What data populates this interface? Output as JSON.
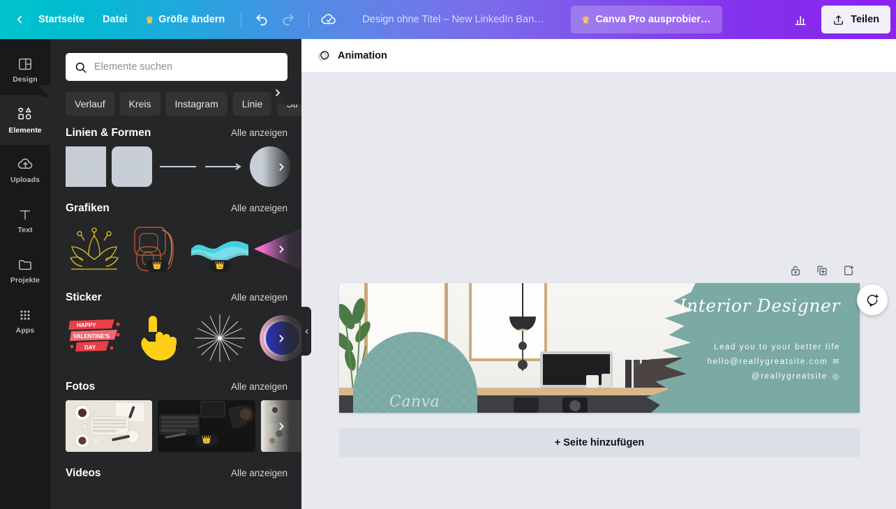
{
  "topbar": {
    "back_icon": "chevron-left-icon",
    "home_label": "Startseite",
    "file_label": "Datei",
    "resize_label": "Größe ändern",
    "resize_crown": "♛",
    "undo_icon": "undo-icon",
    "redo_icon": "redo-icon",
    "cloud_icon": "cloud-saved-icon",
    "doc_title": "Design ohne Titel – New LinkedIn Ban…",
    "pro_label": "Canva Pro ausprobier…",
    "pro_crown": "♛",
    "stats_icon": "bar-chart-icon",
    "share_label": "Teilen",
    "share_icon": "share-upload-icon",
    "gradient_start": "#00C4CC",
    "gradient_end": "#8B22EF"
  },
  "rail": {
    "items": [
      {
        "label": "Design",
        "icon": "layout-icon",
        "active": false
      },
      {
        "label": "Elemente",
        "icon": "shapes-icon",
        "active": true
      },
      {
        "label": "Uploads",
        "icon": "cloud-upload-icon",
        "active": false
      },
      {
        "label": "Text",
        "icon": "text-icon",
        "active": false
      },
      {
        "label": "Projekte",
        "icon": "folder-icon",
        "active": false
      },
      {
        "label": "Apps",
        "icon": "grid-apps-icon",
        "active": false
      }
    ]
  },
  "panel": {
    "search": {
      "placeholder": "Elemente suchen",
      "value": "",
      "icon": "search-icon"
    },
    "chips": [
      "Verlauf",
      "Kreis",
      "Instagram",
      "Linie",
      "Str"
    ],
    "chips_next_icon": "chevron-right-icon",
    "see_all_label": "Alle anzeigen",
    "sections": [
      {
        "title": "Linien & Formen",
        "see_all": "Alle anzeigen",
        "tiles": [
          {
            "kind": "square",
            "pro": false
          },
          {
            "kind": "rounded-square",
            "pro": false
          },
          {
            "kind": "line",
            "pro": false
          },
          {
            "kind": "arrow",
            "pro": false
          },
          {
            "kind": "circle",
            "pro": false
          }
        ]
      },
      {
        "title": "Grafiken",
        "see_all": "Alle anzeigen",
        "tiles": [
          {
            "kind": "lotus-line-art",
            "pro": false
          },
          {
            "kind": "scribble-doodle",
            "pro": true
          },
          {
            "kind": "blue-wave",
            "pro": true
          },
          {
            "kind": "pink-triangle",
            "pro": false
          }
        ]
      },
      {
        "title": "Sticker",
        "see_all": "Alle anzeigen",
        "tiles": [
          {
            "kind": "valentines-banner",
            "pro": false,
            "text": "HAPPY VALENTINE'S DAY"
          },
          {
            "kind": "yellow-hand",
            "pro": false
          },
          {
            "kind": "sparkle-burst",
            "pro": false
          },
          {
            "kind": "blue-flower-badge",
            "pro": false
          }
        ]
      },
      {
        "title": "Fotos",
        "see_all": "Alle anzeigen",
        "tiles": [
          {
            "kind": "photo-light-desk",
            "pro": false
          },
          {
            "kind": "photo-dark-desk",
            "pro": true
          },
          {
            "kind": "photo-flatlay",
            "pro": false
          }
        ]
      },
      {
        "title": "Videos",
        "see_all": "Alle anzeigen",
        "tiles": []
      }
    ],
    "collapse_icon": "chevron-left-icon"
  },
  "workspace": {
    "animation_label": "Animation",
    "animation_icon": "animation-icon",
    "page_tools": [
      {
        "name": "lock-icon",
        "label": "Sperren"
      },
      {
        "name": "duplicate-page-icon",
        "label": "Seite duplizieren"
      },
      {
        "name": "add-page-icon",
        "label": "Seite hinzufügen"
      }
    ],
    "add_page_label": "+ Seite hinzufügen",
    "comment_icon": "add-comment-icon",
    "design": {
      "title": "Interior Designer",
      "tagline": "Lead you to your better life",
      "email": "hello@reallygreatsite.com",
      "email_icon": "envelope-icon",
      "handle": "@reallygreatsite",
      "handle_icon": "instagram-icon",
      "watermark": "Canva",
      "accent_color": "#7BA9A3"
    }
  }
}
